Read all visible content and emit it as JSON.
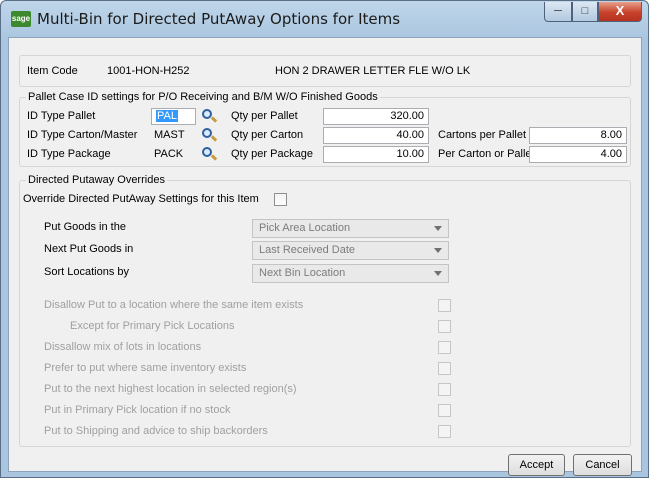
{
  "window": {
    "title": "Multi-Bin for Directed PutAway Options for Items",
    "icon_text": "sage",
    "close_glyph": "X"
  },
  "item": {
    "code_label": "Item Code",
    "code_value": "1001-HON-H252",
    "description": "HON 2 DRAWER LETTER FLE W/O LK"
  },
  "pallet_group": {
    "title": "Pallet Case ID settings for P/O Receiving and B/M W/O Finished Goods",
    "rows": [
      {
        "id_label": "ID Type Pallet",
        "id_value": "PAL",
        "qty_label": "Qty per Pallet",
        "qty_value": "320.00",
        "extra_label": "",
        "extra_value": ""
      },
      {
        "id_label": "ID Type Carton/Master",
        "id_value": "MAST",
        "qty_label": "Qty per Carton",
        "qty_value": "40.00",
        "extra_label": "Cartons per Pallet",
        "extra_value": "8.00"
      },
      {
        "id_label": "ID Type Package",
        "id_value": "PACK",
        "qty_label": "Qty per Package",
        "qty_value": "10.00",
        "extra_label": "Per Carton or Pallet",
        "extra_value": "4.00"
      }
    ]
  },
  "overrides": {
    "title": "Directed Putaway Overrides",
    "override_label": "Override Directed PutAway Settings for this Item",
    "dropdowns": [
      {
        "label": "Put Goods in the",
        "value": "Pick Area Location"
      },
      {
        "label": "Next Put Goods in",
        "value": "Last Received Date"
      },
      {
        "label": "Sort Locations by",
        "value": "Next Bin Location"
      }
    ],
    "options": [
      "Disallow Put to a location where the same item exists",
      "Except for Primary Pick Locations",
      "Dissallow mix of lots in locations",
      "Prefer to put where same inventory exists",
      "Put to the next highest location in selected region(s)",
      "Put in Primary Pick location if no stock",
      "Put to Shipping and advice to ship backorders"
    ]
  },
  "buttons": {
    "accept": "Accept",
    "cancel": "Cancel"
  }
}
